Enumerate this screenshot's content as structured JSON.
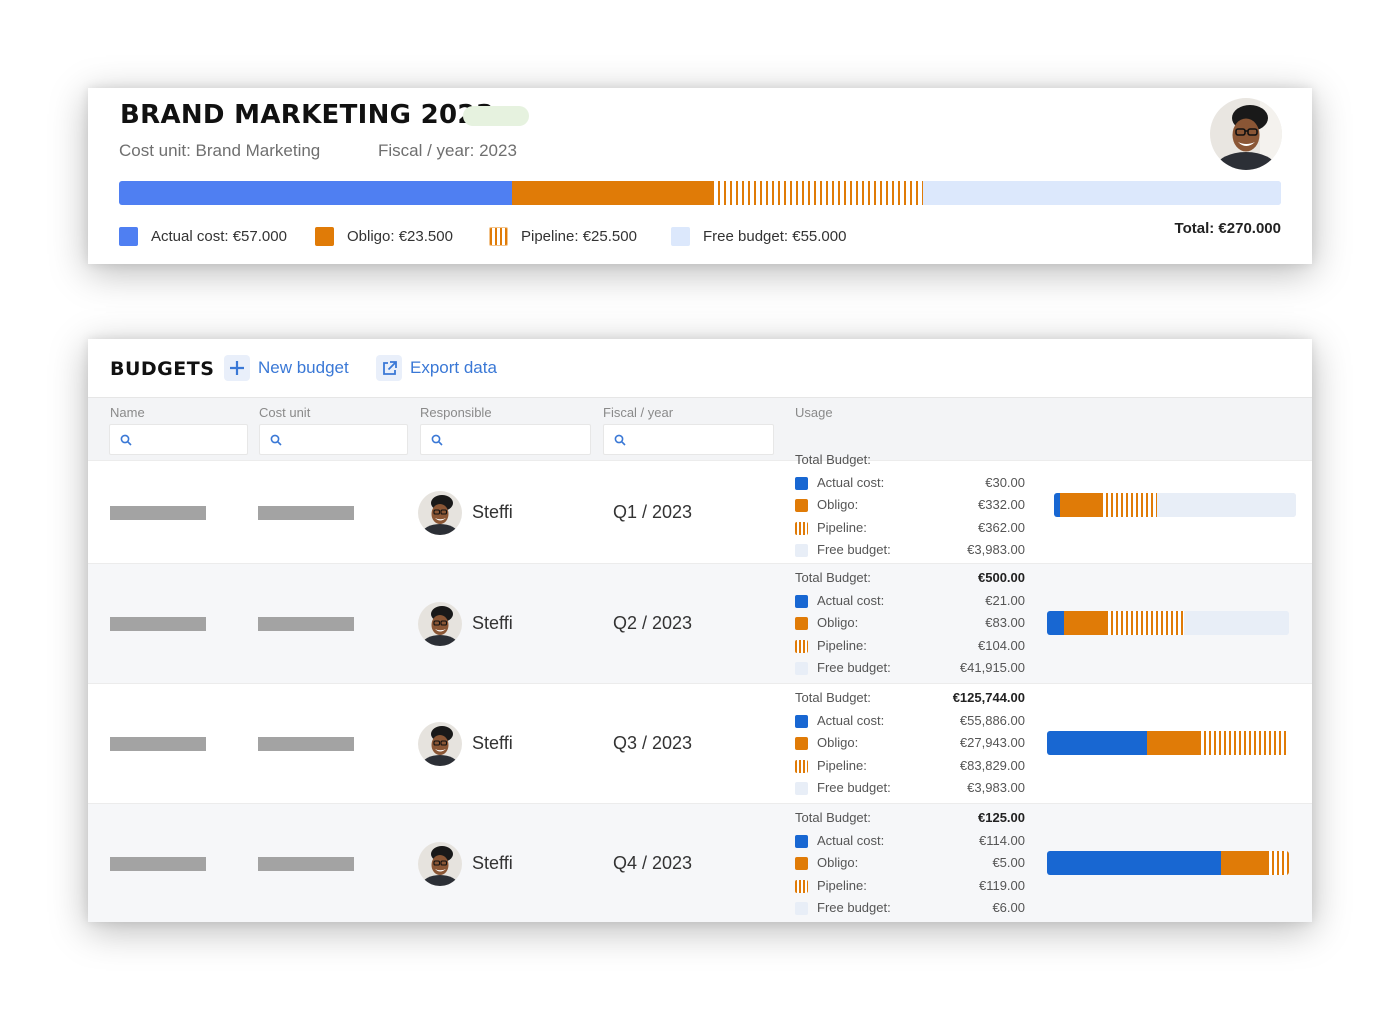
{
  "colors": {
    "actual": "#4f7ff2",
    "actual_row": "#1867d2",
    "obligo": "#e07b07",
    "free": "#dce8fc",
    "link": "#3a78d6"
  },
  "summary": {
    "title": "BRAND MARKETING 2023",
    "cost_unit": "Cost unit: Brand Marketing",
    "fiscal_year": "Fiscal / year: 2023",
    "legend": {
      "actual": "Actual cost: €57.000",
      "obligo": "Obligo: €23.500",
      "pipeline": "Pipeline: €25.500",
      "free": "Free budget: €55.000"
    },
    "total": "Total: €270.000",
    "bar_fractions": {
      "actual": 0.338,
      "obligo": 0.172,
      "pipeline": 0.182,
      "free": 0.308
    }
  },
  "budgets": {
    "title": "BUDGETS",
    "new_budget": "New budget",
    "export_data": "Export data",
    "columns": {
      "name": "Name",
      "cost_unit": "Cost unit",
      "responsible": "Responsible",
      "fiscal_year": "Fiscal / year",
      "usage": "Usage"
    },
    "rows": [
      {
        "responsible": "Steffi",
        "fiscal": "Q1 / 2023",
        "labels": {
          "total": "Total Budget:",
          "actual": "Actual cost:",
          "obligo": "Obligo:",
          "pipeline": "Pipeline:",
          "free": "Free budget:"
        },
        "values": {
          "total": "",
          "actual": "€30.00",
          "obligo": "€332.00",
          "pipeline": "€362.00",
          "free": "€3,983.00"
        },
        "bar": {
          "actual": 0.025,
          "obligo": 0.17,
          "pipeline": 0.23,
          "free": 0.575
        }
      },
      {
        "responsible": "Steffi",
        "fiscal": "Q2 / 2023",
        "labels": {
          "total": "Total Budget:",
          "actual": "Actual cost:",
          "obligo": "Obligo:",
          "pipeline": "Pipeline:",
          "free": "Free budget:"
        },
        "values": {
          "total": "€500.00",
          "actual": "€21.00",
          "obligo": "€83.00",
          "pipeline": "€104.00",
          "free": "€41,915.00"
        },
        "bar": {
          "actual": 0.07,
          "obligo": 0.175,
          "pipeline": 0.32,
          "free": 0.435
        }
      },
      {
        "responsible": "Steffi",
        "fiscal": "Q3 / 2023",
        "labels": {
          "total": "Total Budget:",
          "actual": "Actual cost:",
          "obligo": "Obligo:",
          "pipeline": "Pipeline:",
          "free": "Free budget:"
        },
        "values": {
          "total": "€125,744.00",
          "actual": "€55,886.00",
          "obligo": "€27,943.00",
          "pipeline": "€83,829.00",
          "free": "€3,983.00"
        },
        "bar": {
          "actual": 0.415,
          "obligo": 0.215,
          "pipeline": 0.37,
          "free": 0
        }
      },
      {
        "responsible": "Steffi",
        "fiscal": "Q4 / 2023",
        "labels": {
          "total": "Total Budget:",
          "actual": "Actual cost:",
          "obligo": "Obligo:",
          "pipeline": "Pipeline:",
          "free": "Free budget:"
        },
        "values": {
          "total": "€125.00",
          "actual": "€114.00",
          "obligo": "€5.00",
          "pipeline": "€119.00",
          "free": "€6.00"
        },
        "bar": {
          "actual": 0.72,
          "obligo": 0.19,
          "pipeline": 0.09,
          "free": 0
        }
      }
    ]
  }
}
